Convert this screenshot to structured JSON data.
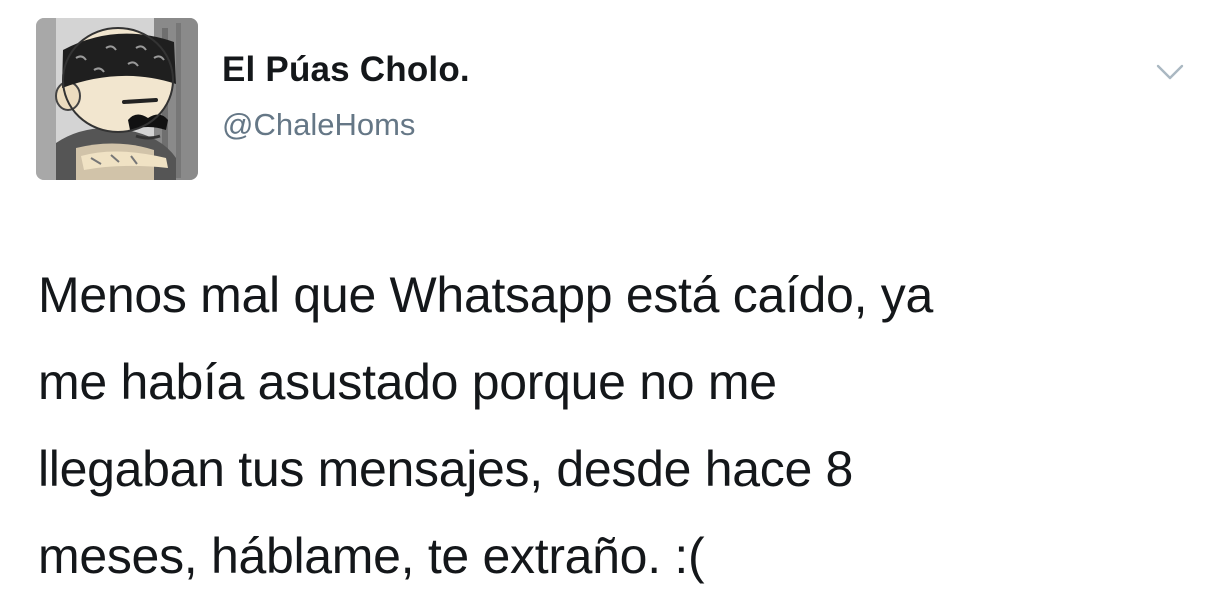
{
  "tweet": {
    "author": {
      "display_name": "El Púas Cholo.",
      "handle": "@ChaleHoms",
      "avatar_icon": "cartoon-cholo-avatar-icon"
    },
    "menu_icon": "chevron-down-icon",
    "text_lines": [
      "Menos mal que Whatsapp está caído, ya",
      "me había asustado porque no me",
      "llegaban tus mensajes, desde hace 8",
      "meses, háblame, te extraño. :("
    ]
  },
  "colors": {
    "text_primary": "#14171a",
    "text_secondary": "#657786",
    "background": "#ffffff"
  }
}
